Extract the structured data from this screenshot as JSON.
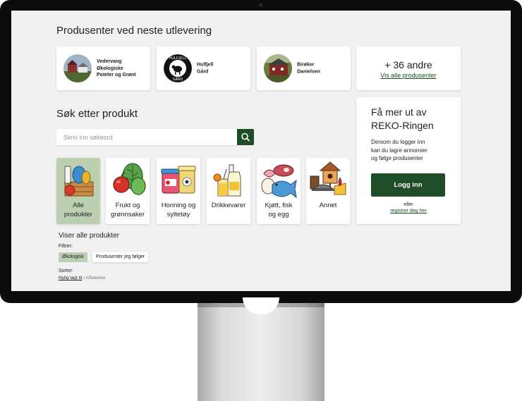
{
  "page": {
    "heading": "Produsenter ved neste utlevering",
    "producers": [
      {
        "name": "Vedervang\nØkologiske\nPoteter og Grønt"
      },
      {
        "name": "Hulfjell\nGård"
      },
      {
        "name": "Birøker\nDanielsen"
      }
    ],
    "more": {
      "title": "+ 36 andre",
      "link": "Vis alle produsenter"
    },
    "search": {
      "heading": "Søk etter produkt",
      "placeholder": "Skriv inn søkeord"
    },
    "categories": [
      {
        "label": "Alle\nprodukter",
        "icon": "vegetable-crate-icon"
      },
      {
        "label": "Frukt og\ngrønnsaker",
        "icon": "apple-spinach-icon"
      },
      {
        "label": "Honning og\nsyltetøy",
        "icon": "jam-jars-icon"
      },
      {
        "label": "Drikkevarer",
        "icon": "bottle-juice-icon"
      },
      {
        "label": "Kjøtt, fisk\nog egg",
        "icon": "meat-fish-egg-icon"
      },
      {
        "label": "Annet",
        "icon": "birdhouse-cheese-icon"
      }
    ],
    "login": {
      "title": "Få mer ut av\nREKO-Ringen",
      "text": "Dersom du logger inn\nkan du lagre annonser\nog følge produsenter",
      "button": "Logg inn",
      "or": "eller",
      "register": "registrer deg her"
    },
    "listing": {
      "showing": "Viser alle produkter",
      "filter_label": "Filtrer:",
      "filters": [
        "Økologisk",
        "Produsenter jeg følger"
      ],
      "sort_label": "Sorter:",
      "sort_options": [
        "Nylig lagt til",
        "Alfabetisk"
      ],
      "sort_separator": " / "
    }
  },
  "colors": {
    "accent": "#1f4d26",
    "active_category": "#bccfb1",
    "background": "#f1f1f1"
  }
}
